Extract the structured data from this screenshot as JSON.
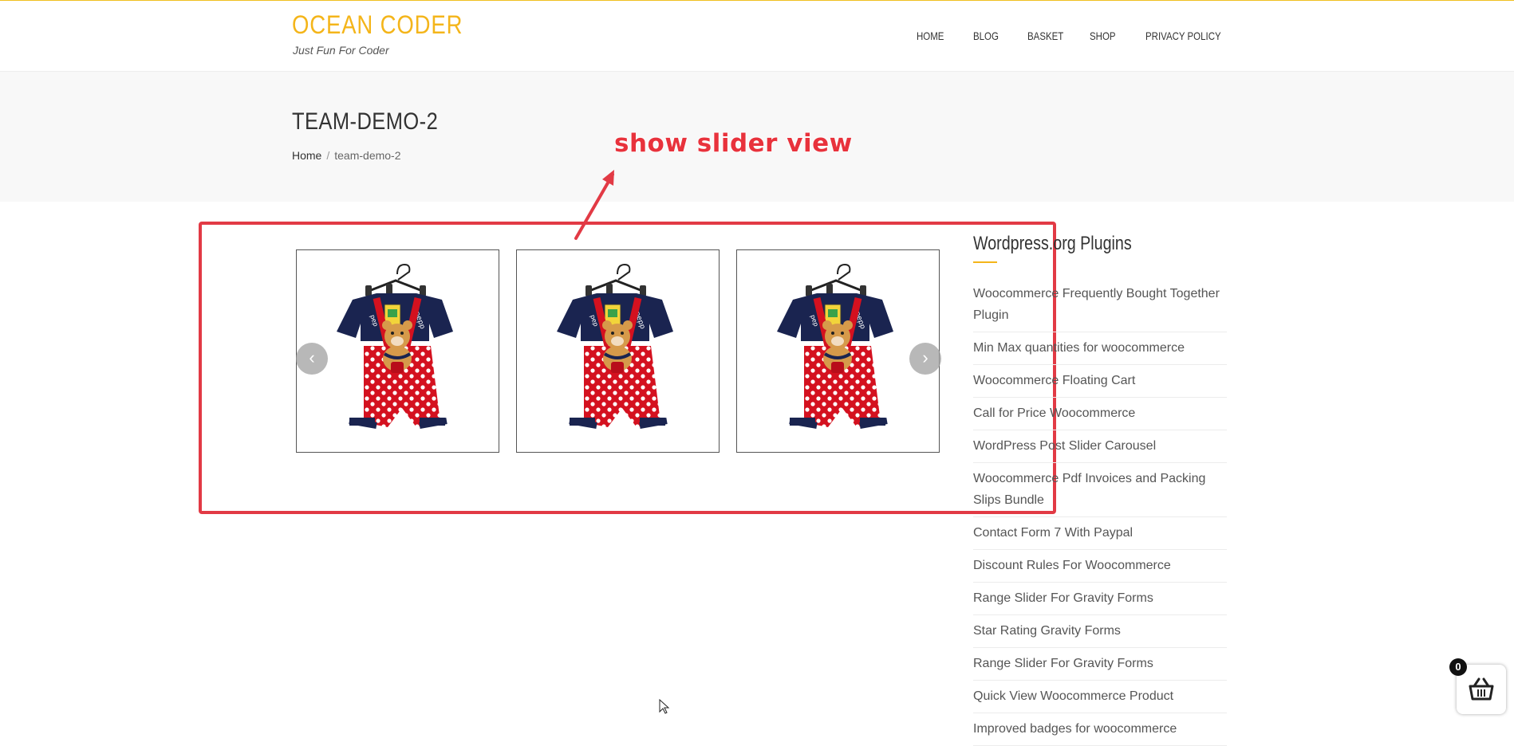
{
  "site": {
    "title": "OCEAN CODER",
    "tagline": "Just Fun For Coder",
    "accent_color": "#f4b51a"
  },
  "nav": {
    "items": [
      {
        "label": "HOME"
      },
      {
        "label": "BLOG"
      },
      {
        "label": "BASKET"
      },
      {
        "label": "SHOP"
      },
      {
        "label": "PRIVACY POLICY"
      }
    ]
  },
  "page": {
    "title": "TEAM-DEMO-2",
    "breadcrumb": {
      "home": "Home",
      "separator": "/",
      "current": "team-demo-2"
    }
  },
  "annotation": {
    "text": "show slider view",
    "color": "#e23a45"
  },
  "slider": {
    "prev_icon": "chevron-left-icon",
    "next_icon": "chevron-right-icon",
    "prev_glyph": "‹",
    "next_glyph": "›",
    "slides": [
      {
        "image": "kids-romper-polka-dot-teddy"
      },
      {
        "image": "kids-romper-polka-dot-teddy"
      },
      {
        "image": "kids-romper-polka-dot-teddy"
      }
    ]
  },
  "sidebar": {
    "widget_title": "Wordpress.org Plugins",
    "plugins": [
      "Woocommerce Frequently Bought Together Plugin",
      "Min Max quantities for woocommerce",
      "Woocommerce Floating Cart",
      "Call for Price Woocommerce",
      "WordPress Post Slider Carousel",
      "Woocommerce Pdf Invoices and Packing Slips Bundle",
      "Contact Form 7 With Paypal",
      "Discount Rules For Woocommerce",
      "Range Slider For Gravity Forms",
      "Star Rating Gravity Forms",
      "Range Slider For Gravity Forms",
      "Quick View Woocommerce Product",
      "Improved badges for woocommerce"
    ]
  },
  "cart": {
    "count": "0",
    "icon": "basket-icon"
  }
}
